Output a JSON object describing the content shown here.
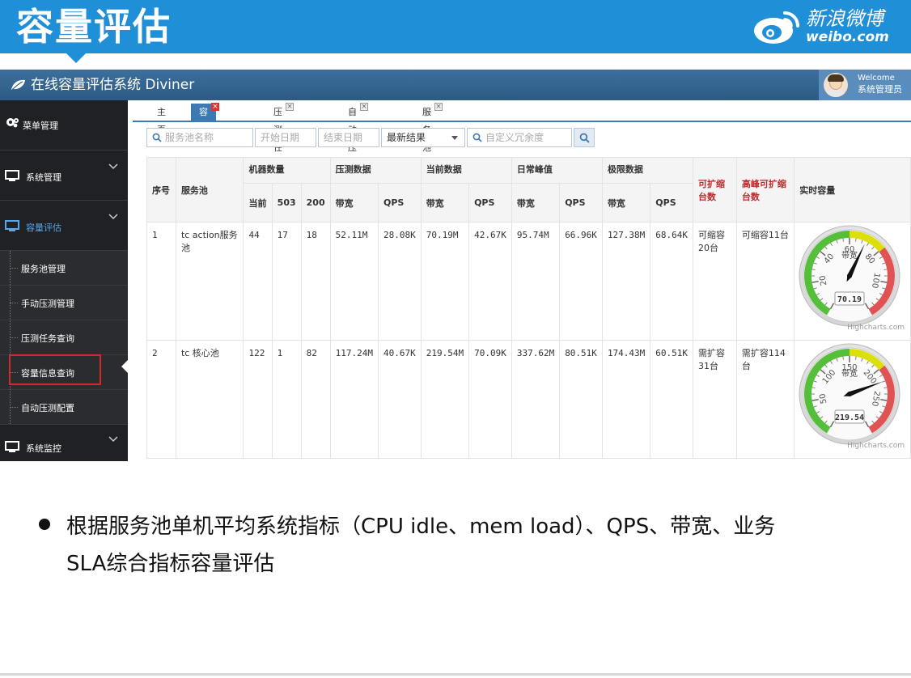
{
  "slide": {
    "title": "容量评估",
    "logo_cn": "新浪微博",
    "logo_en": "weibo.com",
    "bullet_line1": "根据服务池单机平均系统指标（CPU idle、mem load）、QPS、带宽、业务",
    "bullet_line2": "SLA综合指标容量评估"
  },
  "app": {
    "title": "在线容量评估系统 Diviner",
    "welcome": "Welcome",
    "username": "系统管理员"
  },
  "sidebar": {
    "items": [
      {
        "label": "菜单管理",
        "icon": "gear-cog-icon"
      },
      {
        "label": "系统管理",
        "icon": "monitor-icon"
      },
      {
        "label": "容量评估",
        "icon": "monitor-icon"
      },
      {
        "label": "系统监控",
        "icon": "monitor-icon"
      }
    ],
    "sub_items": [
      {
        "label": "服务池管理"
      },
      {
        "label": "手动压测管理"
      },
      {
        "label": "压测任务查询"
      },
      {
        "label": "容量信息查询"
      },
      {
        "label": "自动压测配置"
      }
    ]
  },
  "tabs": [
    {
      "label": "主页"
    },
    {
      "label": "容量信息查询"
    },
    {
      "label": "压测任务查询"
    },
    {
      "label": "自动压测配置"
    },
    {
      "label": "服务池管理"
    }
  ],
  "filters": {
    "pool_placeholder": "服务池名称",
    "start_placeholder": "开始日期",
    "end_placeholder": "结束日期",
    "result_value": "最新结果",
    "redundancy_placeholder": "自定义冗余度"
  },
  "table": {
    "headers": {
      "seq": "序号",
      "pool": "服务池",
      "machines": "机器数量",
      "current": "当前",
      "c503": "503",
      "c200": "200",
      "stress": "压测数据",
      "now": "当前数据",
      "daily": "日常峰值",
      "limit": "极限数据",
      "bw": "带宽",
      "qps": "QPS",
      "scalable": "可扩缩台数",
      "peak_scalable": "高峰可扩缩台数",
      "realtime": "实时容量"
    },
    "rows": [
      {
        "seq": "1",
        "pool": "tc action服务池",
        "current": "44",
        "c503": "17",
        "c200": "18",
        "stress_bw": "52.11M",
        "stress_qps": "28.08K",
        "now_bw": "70.19M",
        "now_qps": "42.67K",
        "daily_bw": "95.74M",
        "daily_qps": "66.96K",
        "limit_bw": "127.38M",
        "limit_qps": "68.64K",
        "scalable": "可缩容20台",
        "peak_scalable": "可缩容11台"
      },
      {
        "seq": "2",
        "pool": "tc 核心池",
        "current": "122",
        "c503": "1",
        "c200": "82",
        "stress_bw": "117.24M",
        "stress_qps": "40.67K",
        "now_bw": "219.54M",
        "now_qps": "70.09K",
        "daily_bw": "337.62M",
        "daily_qps": "80.51K",
        "limit_bw": "174.43M",
        "limit_qps": "60.51K",
        "scalable": "需扩容31台",
        "peak_scalable": "需扩容114台"
      }
    ]
  },
  "gauges": [
    {
      "value": 70.19,
      "display": "70.19",
      "label": "带宽",
      "ticks": [
        "20",
        "40",
        "60",
        "80",
        "100"
      ],
      "min": 0,
      "max": 120,
      "credit": "Highcharts.com"
    },
    {
      "value": 219.54,
      "display": "219.54",
      "label": "带宽",
      "ticks": [
        "50",
        "100",
        "150",
        "200",
        "250"
      ],
      "min": 0,
      "max": 300,
      "credit": "Highcharts.com"
    }
  ],
  "colors": {
    "header_blue": "#1f8fd8",
    "topbar_blue": "#2c5a85",
    "sidebar_dark": "#202124",
    "highlight_red": "#d02a2a",
    "gauge_green": "#55bf3b",
    "gauge_yellow": "#dddf0d",
    "gauge_red": "#df5353"
  }
}
